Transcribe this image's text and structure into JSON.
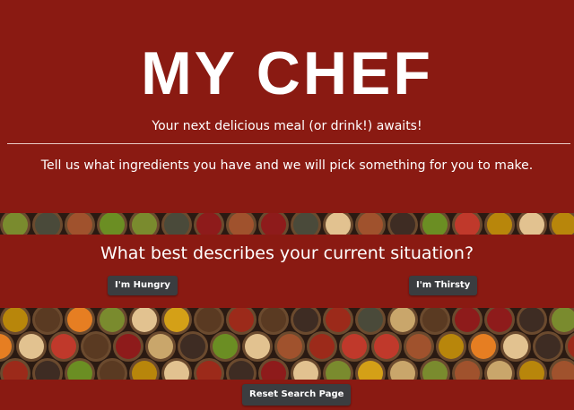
{
  "header": {
    "title": "MY CHEF",
    "tagline": "Your next delicious meal (or drink!) awaits!",
    "instructions": "Tell us what ingredients you have and we will pick something for you to make."
  },
  "situation": {
    "question": "What best describes your current situation?",
    "hungry_label": "I'm Hungry",
    "thirsty_label": "I'm Thirsty"
  },
  "footer": {
    "reset_label": "Reset Search Page"
  },
  "colors": {
    "background": "#8a1a12",
    "button": "#3b3d40",
    "text": "#ffffff"
  },
  "icons": {
    "spice_banner": "spice-bowls-image"
  }
}
